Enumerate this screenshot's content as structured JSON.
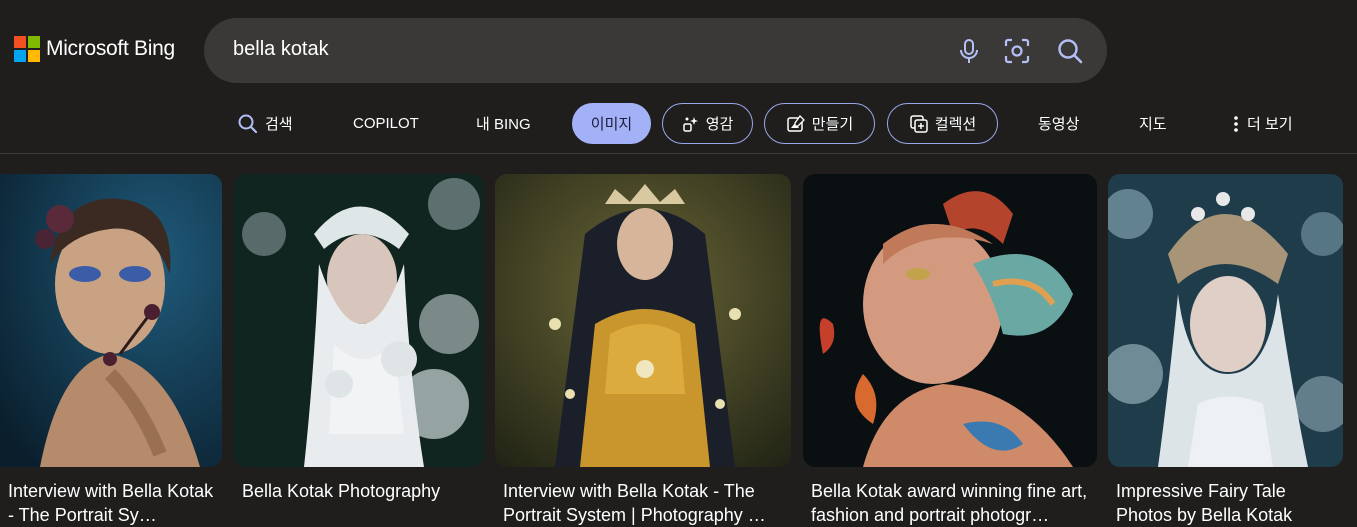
{
  "brand": {
    "name": "Microsoft Bing",
    "logo_colors": [
      "#f25022",
      "#7fba00",
      "#00a4ef",
      "#ffb900"
    ]
  },
  "search": {
    "query": "bella kotak",
    "icons": [
      "microphone-icon",
      "visual-search-icon",
      "search-icon"
    ]
  },
  "nav": {
    "items": [
      {
        "label": "검색",
        "icon": "search-icon"
      },
      {
        "label": "COPILOT"
      },
      {
        "label": "내 BING"
      },
      {
        "label": "이미지",
        "active": true
      },
      {
        "label": "영감",
        "icon": "sparkle-icon"
      },
      {
        "label": "만들기",
        "icon": "image-create-icon"
      },
      {
        "label": "컬렉션",
        "icon": "collection-icon"
      },
      {
        "label": "동영상"
      },
      {
        "label": "지도"
      },
      {
        "label": "더 보기",
        "icon": "more-dots-icon"
      }
    ]
  },
  "colors": {
    "accent": "#a3b1f7",
    "background": "#1f1e1d",
    "search_bg": "#3a3938"
  },
  "results": [
    {
      "caption": "Interview with Bella Kotak - The Portrait Sy…"
    },
    {
      "caption": "Bella Kotak Photography"
    },
    {
      "caption": "Interview with Bella Kotak - The Portrait System | Photography …"
    },
    {
      "caption": "Bella Kotak award winning fine art, fashion and portrait photogr…"
    },
    {
      "caption": "Impressive Fairy Tale Photos by Bella Kotak"
    }
  ]
}
